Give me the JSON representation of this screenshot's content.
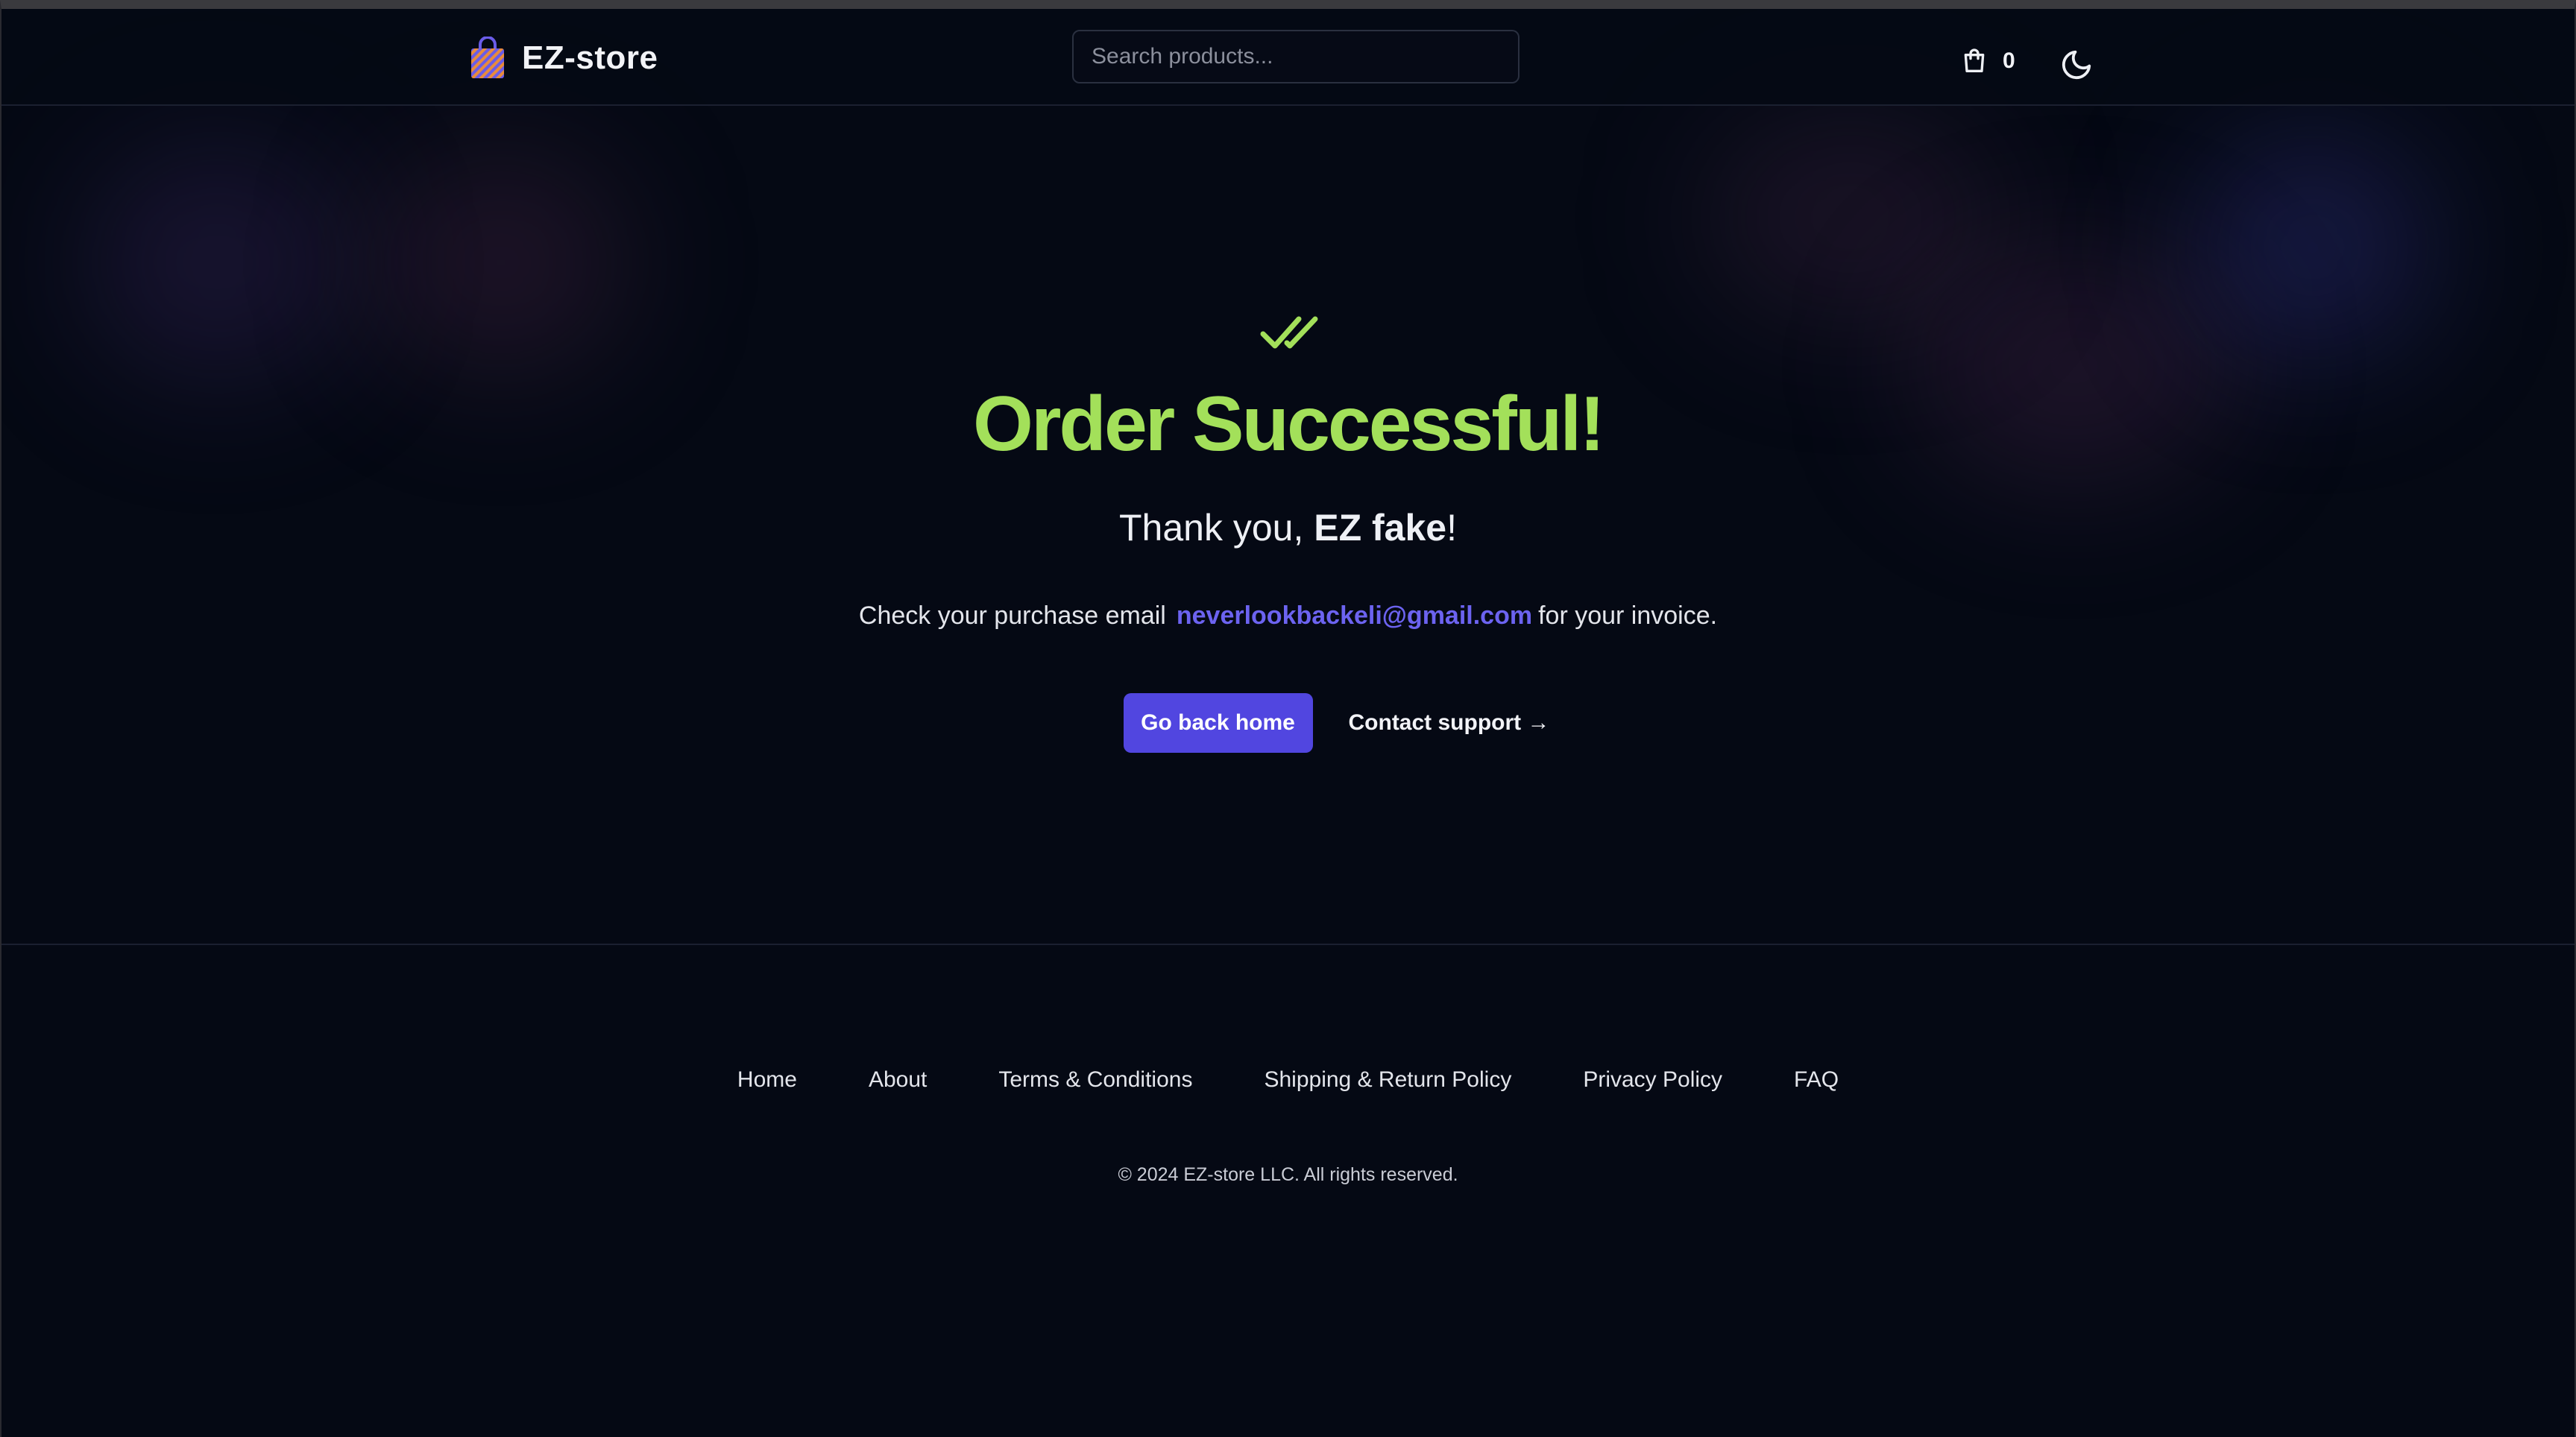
{
  "header": {
    "brand": "EZ-store",
    "search_placeholder": "Search products...",
    "cart_count": "0"
  },
  "main": {
    "title": "Order Successful!",
    "thanks_prefix": "Thank you, ",
    "customer_name": "EZ fake",
    "thanks_suffix": "!",
    "email_prefix": "Check your purchase email",
    "email": "neverlookbackeli@gmail.com",
    "email_suffix": "for your invoice.",
    "home_button": "Go back home",
    "support_link": "Contact support →"
  },
  "footer": {
    "links": [
      "Home",
      "About",
      "Terms & Conditions",
      "Shipping & Return Policy",
      "Privacy Policy",
      "FAQ"
    ],
    "copyright": "© 2024 EZ-store LLC. All rights reserved."
  },
  "icons": {
    "logo": "shopping-bag-icon",
    "cart": "shopping-bag-outline-icon",
    "theme": "moon-icon",
    "success": "double-check-icon"
  },
  "colors": {
    "background": "#050914",
    "accent": "#5146e0",
    "success": "#a3e05a",
    "email_link": "#6c63f0"
  }
}
